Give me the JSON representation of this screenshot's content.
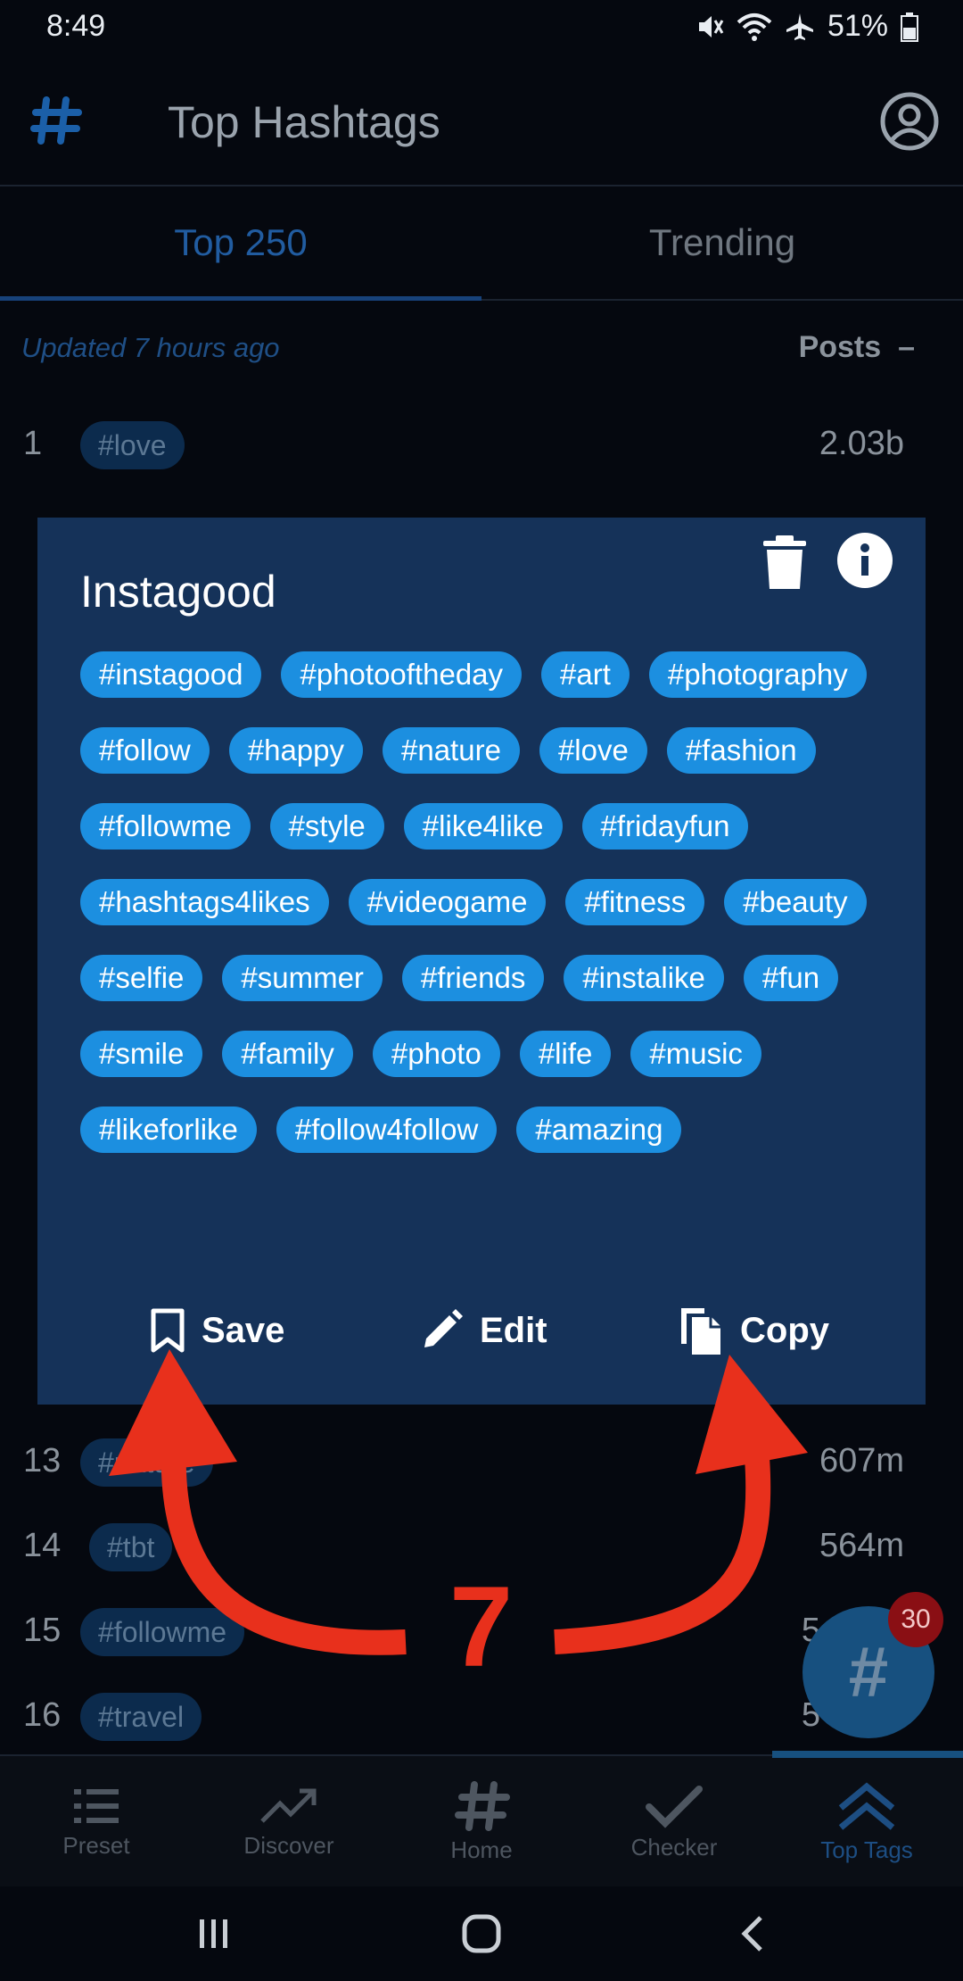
{
  "status_bar": {
    "time": "8:49",
    "battery": "51%"
  },
  "app": {
    "title": "Top Hashtags"
  },
  "tabs": [
    {
      "label": "Top 250",
      "active": true
    },
    {
      "label": "Trending",
      "active": false
    }
  ],
  "list": {
    "updated": "Updated 7 hours ago",
    "posts_header": "Posts",
    "sort_symbol": "–",
    "rows": [
      {
        "rank": "1",
        "tag": "#love",
        "posts": "2.03b"
      },
      {
        "rank": "13",
        "tag": "#nature",
        "posts": "607m"
      },
      {
        "rank": "14",
        "tag": "#tbt",
        "posts": "564m"
      },
      {
        "rank": "15",
        "tag": "#followme",
        "posts": "5"
      },
      {
        "rank": "16",
        "tag": "#travel",
        "posts": "5"
      }
    ]
  },
  "modal": {
    "title": "Instagood",
    "tags": [
      "#instagood",
      "#photooftheday",
      "#art",
      "#photography",
      "#follow",
      "#happy",
      "#nature",
      "#love",
      "#fashion",
      "#followme",
      "#style",
      "#like4like",
      "#fridayfun",
      "#hashtags4likes",
      "#videogame",
      "#fitness",
      "#beauty",
      "#selfie",
      "#summer",
      "#friends",
      "#instalike",
      "#fun",
      "#smile",
      "#family",
      "#photo",
      "#life",
      "#music",
      "#likeforlike",
      "#follow4follow",
      "#amazing"
    ],
    "actions": {
      "save": "Save",
      "edit": "Edit",
      "copy": "Copy"
    },
    "chip_color": "#1c8fe0",
    "background_color": "#153259"
  },
  "annotation": {
    "number": "7",
    "color": "#e8301c"
  },
  "fab": {
    "symbol": "#",
    "badge": "30"
  },
  "bottom_nav": [
    {
      "label": "Preset",
      "icon": "list-icon"
    },
    {
      "label": "Discover",
      "icon": "trending-up-icon"
    },
    {
      "label": "Home",
      "icon": "hash-icon"
    },
    {
      "label": "Checker",
      "icon": "checkmark-icon"
    },
    {
      "label": "Top Tags",
      "icon": "double-chevron-up-icon",
      "active": true
    }
  ]
}
